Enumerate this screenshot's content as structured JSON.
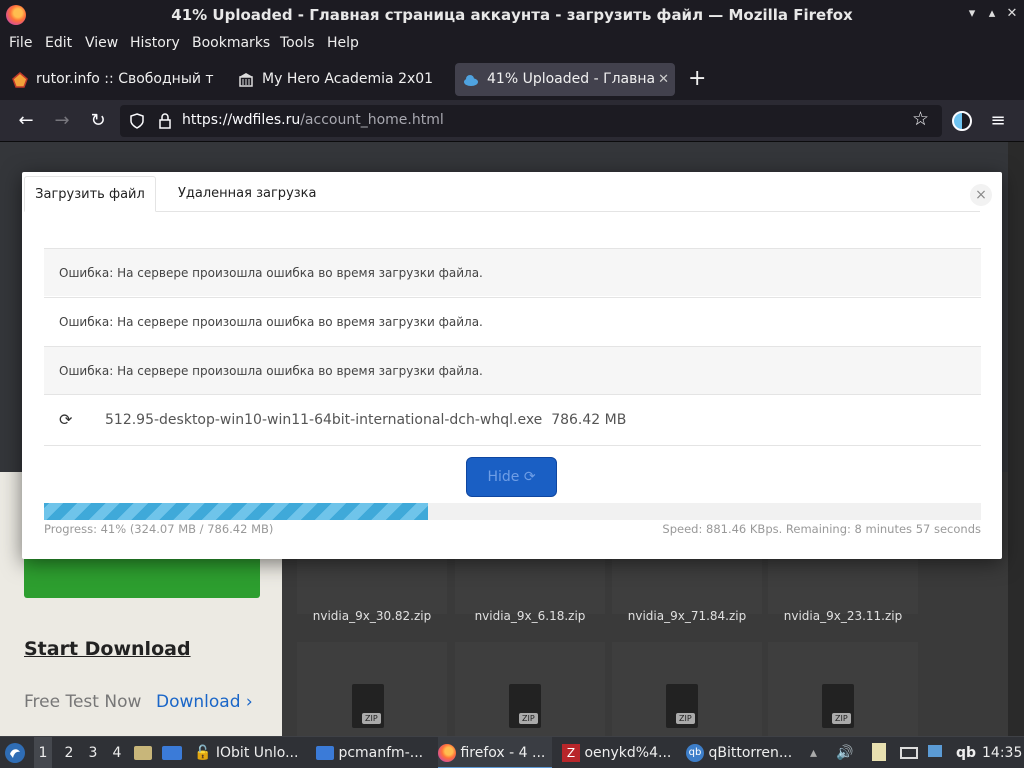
{
  "window": {
    "title": "41% Uploaded - Главная страница аккаунта - загрузить файл — Mozilla Firefox"
  },
  "menu": [
    "File",
    "Edit",
    "View",
    "History",
    "Bookmarks",
    "Tools",
    "Help"
  ],
  "tabs": [
    {
      "label": "rutor.info :: Свободный т"
    },
    {
      "label": "My Hero Academia 2x01"
    },
    {
      "label": "41% Uploaded - Главна"
    }
  ],
  "url": {
    "host": "https://wdfiles.ru",
    "path": "/account_home.html"
  },
  "modal": {
    "tabs": [
      "Загрузить файл",
      "Удаленная загрузка"
    ],
    "close": "×",
    "errors": [
      "Ошибка: На сервере произошла ошибка во время загрузки файла.",
      "Ошибка: На сервере произошла ошибка во время загрузки файла.",
      "Ошибка: На сервере произошла ошибка во время загрузки файла."
    ],
    "file": {
      "name": "512.95-desktop-win10-win11-64bit-international-dch-whql.exe",
      "size": "786.42 MB"
    },
    "hide_label": "Hide",
    "progress": {
      "percent": 41,
      "text": "Progress: 41% (324.07 MB / 786.42 MB)",
      "speed": "Speed: 881.46 KBps. Remaining: 8 minutes 57 seconds"
    }
  },
  "page": {
    "files": [
      "nvidia_9x_30.82.zip",
      "nvidia_9x_6.18.zip",
      "nvidia_9x_71.84.zip",
      "nvidia_9x_23.11.zip"
    ],
    "zip_label": "ZIP",
    "start_download": "Start Download",
    "free_test": "Free Test Now",
    "download_link": "Download"
  },
  "taskbar": {
    "workspaces": [
      "1",
      "2",
      "3",
      "4"
    ],
    "items": [
      "IObit Unlo...",
      "pcmanfm-...",
      "firefox - 4 ...",
      "oenykd%4...",
      "qBittorren..."
    ],
    "tray_qb": "qb",
    "clock": "14:35"
  },
  "colors": {
    "accent": "#1a5fc4",
    "progress": "#3fa9d9"
  }
}
